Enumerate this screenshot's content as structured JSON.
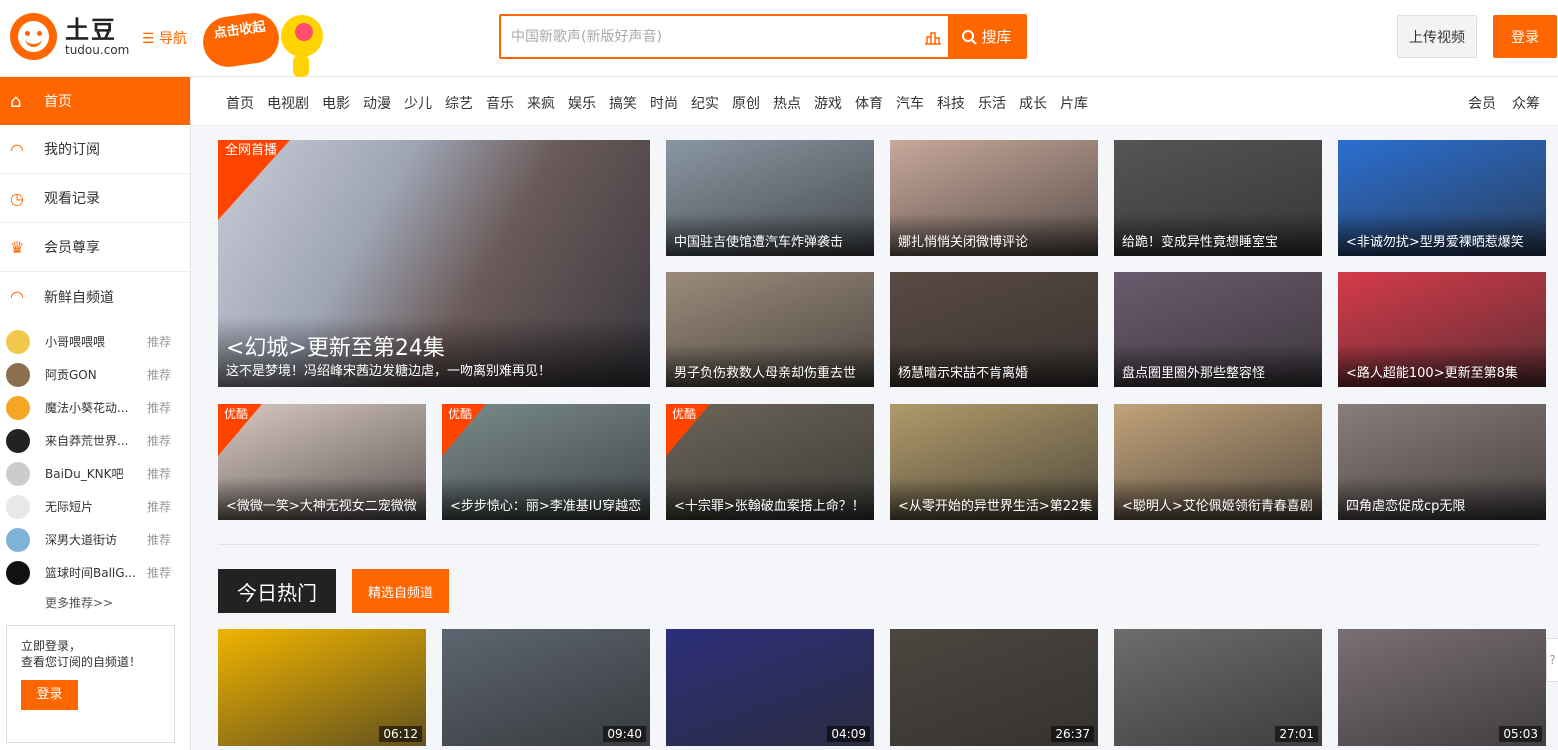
{
  "header": {
    "logo_cn": "土豆",
    "logo_en": "tudou.com",
    "nav_label": "导航",
    "promo_text": "点击收起",
    "search_placeholder": "中国新歌声(新版好声音)",
    "search_button": "搜库",
    "upload_button": "上传视频",
    "login_button": "登录"
  },
  "sidebar": {
    "home": "首页",
    "items": [
      "我的订阅",
      "观看记录",
      "会员尊享",
      "新鲜自频道"
    ],
    "subs": [
      {
        "name": "小哥喂喂喂",
        "rec": "推荐",
        "color": "#f2c94c"
      },
      {
        "name": "阿贡GON",
        "rec": "推荐",
        "color": "#8b6f4e"
      },
      {
        "name": "魔法小葵花动...",
        "rec": "推荐",
        "color": "#f6a623"
      },
      {
        "name": "来自莽荒世界...",
        "rec": "推荐",
        "color": "#222222"
      },
      {
        "name": "BaiDu_KNK吧",
        "rec": "推荐",
        "color": "#cccccc"
      },
      {
        "name": "无际短片",
        "rec": "推荐",
        "color": "#e8e8e8"
      },
      {
        "name": "深男大道街访",
        "rec": "推荐",
        "color": "#7fb3d5"
      },
      {
        "name": "篮球时间BallG...",
        "rec": "推荐",
        "color": "#111111"
      }
    ],
    "more": "更多推荐>>",
    "login_prompt_1": "立即登录，",
    "login_prompt_2": "查看您订阅的自频道！",
    "login_btn": "登录"
  },
  "channels": [
    "首页",
    "电视剧",
    "电影",
    "动漫",
    "少儿",
    "综艺",
    "音乐",
    "来疯",
    "娱乐",
    "搞笑",
    "时尚",
    "纪实",
    "原创",
    "热点",
    "游戏",
    "体育",
    "汽车",
    "科技",
    "乐活",
    "成长",
    "片库"
  ],
  "channels_right": [
    "会员",
    "众筹"
  ],
  "feature": {
    "badge": "全网首播",
    "title": "<幻城>更新至第24集",
    "subtitle": "这不是梦境！冯绍峰宋茜边发糖边虐，一吻离别难再见！"
  },
  "grid": [
    {
      "cap": "中国驻吉使馆遭汽车炸弹袭击",
      "color": "#8a97a3"
    },
    {
      "cap": "娜扎悄悄关闭微博评论",
      "color": "#c8a89a"
    },
    {
      "cap": "给跪！变成异性竟想睡室宝",
      "color": "#555555"
    },
    {
      "cap": "<非诚勿扰>型男爱裸晒惹爆笑",
      "color": "#2b6fd1"
    },
    {
      "cap": "男子负伤救数人母亲却伤重去世",
      "color": "#9c8b7a"
    },
    {
      "cap": "杨慧暗示宋喆不肯离婚",
      "color": "#5a4a42"
    },
    {
      "cap": "盘点圈里圈外那些整容怪",
      "color": "#6b5a6e"
    },
    {
      "cap": "<路人超能100>更新至第8集",
      "color": "#d63a4a"
    }
  ],
  "row3": [
    {
      "cap": "<微微一笑>大神无视女二宠微微",
      "badge": "优酷",
      "color": "#d9c8c0"
    },
    {
      "cap": "<步步惊心：丽>李准基IU穿越恋",
      "badge": "优酷",
      "color": "#7a8a8c"
    },
    {
      "cap": "<十宗罪>张翰破血案搭上命？！",
      "badge": "优酷",
      "color": "#6b6458"
    },
    {
      "cap": "<从零开始的异世界生活>第22集",
      "badge": "",
      "color": "#b09a6a"
    },
    {
      "cap": "<聪明人>艾伦佩姬领衔青春喜剧",
      "badge": "",
      "color": "#c2a27a"
    },
    {
      "cap": "四角虐恋促成cp无限",
      "badge": "",
      "color": "#8a7d7a"
    }
  ],
  "hot": {
    "title": "今日热门",
    "link": "精选自频道",
    "items": [
      {
        "dur": "06:12",
        "color": "#f0b400"
      },
      {
        "dur": "09:40",
        "color": "#5d6570"
      },
      {
        "dur": "04:09",
        "color": "#2c2f7a"
      },
      {
        "dur": "26:37",
        "color": "#4d4640"
      },
      {
        "dur": "27:01",
        "color": "#6d6d6d"
      },
      {
        "dur": "05:03",
        "color": "#7a6f75"
      }
    ]
  },
  "help": "?"
}
